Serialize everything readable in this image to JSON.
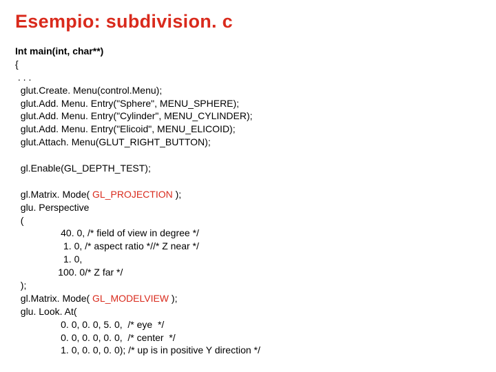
{
  "title": "Esempio: subdivision. c",
  "code": {
    "signature": "Int main(int, char**)",
    "l1": "{",
    "l2": " . . .",
    "l3": "  glut.Create. Menu(control.Menu);",
    "l4": "  glut.Add. Menu. Entry(\"Sphere\", MENU_SPHERE);",
    "l5": "  glut.Add. Menu. Entry(\"Cylinder\", MENU_CYLINDER);",
    "l6": "  glut.Add. Menu. Entry(\"Elicoid\", MENU_ELICOID);",
    "l7": "  glut.Attach. Menu(GLUT_RIGHT_BUTTON);",
    "l8": "",
    "l9": "  gl.Enable(GL_DEPTH_TEST);",
    "l10": "",
    "l11a": "  gl.Matrix. Mode( ",
    "l11b": "GL_PROJECTION",
    "l11c": " );",
    "l12": "  glu. Perspective",
    "l13": "  (",
    "l14": "                 40. 0, /* field of view in degree */",
    "l15": "                  1. 0, /* aspect ratio *//* Z near */",
    "l16": "                  1. 0,",
    "l17": "                100. 0/* Z far */",
    "l18": "  );",
    "l19a": "  gl.Matrix. Mode( ",
    "l19b": "GL_MODELVIEW",
    "l19c": " );",
    "l20": "  glu. Look. At(",
    "l21": "                 0. 0, 0. 0, 5. 0,  /* eye  */",
    "l22": "                 0. 0, 0. 0, 0. 0,  /* center  */",
    "l23": "                 1. 0, 0. 0, 0. 0); /* up is in positive Y direction */"
  }
}
